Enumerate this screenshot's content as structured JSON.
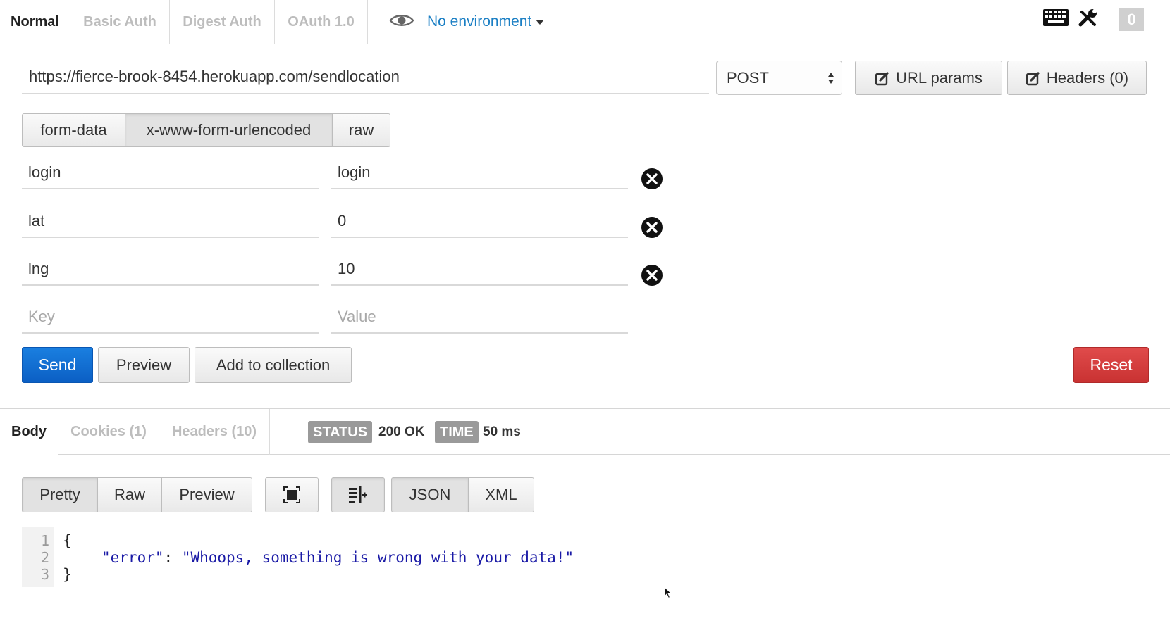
{
  "auth_tabs": [
    {
      "label": "Normal",
      "active": true
    },
    {
      "label": "Basic Auth",
      "active": false
    },
    {
      "label": "Digest Auth",
      "active": false
    },
    {
      "label": "OAuth 1.0",
      "active": false
    }
  ],
  "environment": {
    "label": "No environment",
    "icon": "eye-icon"
  },
  "toolbar": {
    "badge_count": "0"
  },
  "request": {
    "url": "https://fierce-brook-8454.herokuapp.com/sendlocation",
    "method": "POST",
    "url_params_label": "URL params",
    "headers_label": "Headers (0)"
  },
  "body_modes": [
    {
      "label": "form-data",
      "active": false
    },
    {
      "label": "x-www-form-urlencoded",
      "active": true
    },
    {
      "label": "raw",
      "active": false
    }
  ],
  "params": [
    {
      "key": "login",
      "value": "login"
    },
    {
      "key": "lat",
      "value": "0"
    },
    {
      "key": "lng",
      "value": "10"
    }
  ],
  "new_param": {
    "key_placeholder": "Key",
    "value_placeholder": "Value"
  },
  "actions": {
    "send": "Send",
    "preview": "Preview",
    "add_to_collection": "Add to collection",
    "reset": "Reset"
  },
  "response_tabs": [
    {
      "label": "Body",
      "active": true
    },
    {
      "label": "Cookies (1)",
      "active": false
    },
    {
      "label": "Headers (10)",
      "active": false
    }
  ],
  "response_meta": {
    "status_label": "STATUS",
    "status_value": "200 OK",
    "time_label": "TIME",
    "time_value": "50 ms"
  },
  "view_modes": [
    {
      "label": "Pretty",
      "active": true
    },
    {
      "label": "Raw",
      "active": false
    },
    {
      "label": "Preview",
      "active": false
    }
  ],
  "format_modes": [
    {
      "label": "JSON",
      "active": true
    },
    {
      "label": "XML",
      "active": false
    }
  ],
  "response_body": {
    "line_numbers": [
      "1",
      "2",
      "3"
    ],
    "open_brace": "{",
    "key": "\"error\"",
    "colon": ": ",
    "value": "\"Whoops, something is wrong with your data!\"",
    "close_brace": "}"
  },
  "colors": {
    "accent_link": "#1b7fc4",
    "send_blue": "#0b5fc4",
    "reset_red": "#c93232",
    "status_pill": "#9a9a9a"
  }
}
